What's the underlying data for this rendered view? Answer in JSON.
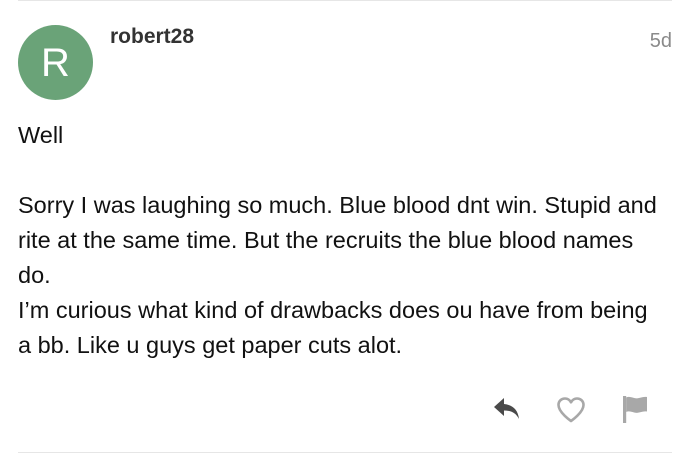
{
  "post": {
    "avatar_letter": "R",
    "avatar_color": "#6aa378",
    "username": "robert28",
    "age": "5d",
    "body": {
      "greeting": "Well",
      "line1": "Sorry I was laughing so much. Blue blood dnt win. Stupid and rite at the same time. But the recruits the blue blood names do.",
      "line2": "I’m curious what kind of drawbacks does ou have from being a bb. Like u guys get paper cuts alot."
    }
  },
  "actions": {
    "reply_icon": "reply-icon",
    "like_icon": "heart-outline-icon",
    "flag_icon": "flag-icon",
    "icon_color_dark": "#4a4a4a",
    "icon_color_light": "#a8a8a8"
  }
}
